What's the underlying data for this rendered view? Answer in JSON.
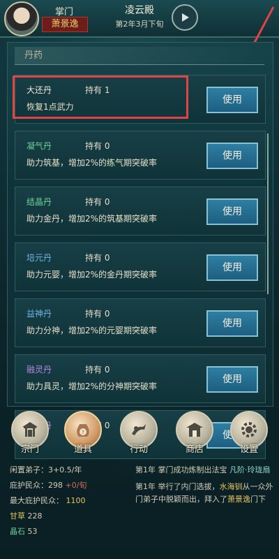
{
  "header": {
    "rank": "掌门",
    "player_name": "萧景逸",
    "sect_name": "凌云殿",
    "date": "第2年3月下旬"
  },
  "section_title": "丹药",
  "items": [
    {
      "name": "大还丹",
      "count_text": "持有 1",
      "desc": "恢复1点武力",
      "button": "使用",
      "name_color": "#f0e8d6"
    },
    {
      "name": "凝气丹",
      "count_text": "持有 0",
      "desc": "助力筑基，增加2%的练气期突破率",
      "button": "使用",
      "name_color": "#6fd19a"
    },
    {
      "name": "结晶丹",
      "count_text": "持有 0",
      "desc": "助力金丹，增加2%的筑基期突破率",
      "button": "使用",
      "name_color": "#6fd19a"
    },
    {
      "name": "培元丹",
      "count_text": "持有 0",
      "desc": "助力元婴，增加2%的金丹期突破率",
      "button": "使用",
      "name_color": "#6fb4e0"
    },
    {
      "name": "益神丹",
      "count_text": "持有 0",
      "desc": "助力分神，增加2%的元婴期突破率",
      "button": "使用",
      "name_color": "#6fb4e0"
    },
    {
      "name": "融灵丹",
      "count_text": "持有 0",
      "desc": "助力具灵，增加2%的分神期突破率",
      "button": "使用",
      "name_color": "#b487e0"
    },
    {
      "name": "化罡丹",
      "count_text": "持有 0",
      "desc": "",
      "button": "使用",
      "name_color": "#b487e0"
    }
  ],
  "nav": [
    {
      "label": "宗门",
      "icon": "gate-icon"
    },
    {
      "label": "道具",
      "icon": "bag-icon"
    },
    {
      "label": "行动",
      "icon": "action-icon"
    },
    {
      "label": "商店",
      "icon": "shop-icon"
    },
    {
      "label": "设置",
      "icon": "gear-icon"
    }
  ],
  "stats": {
    "disciples": "闲置弟子：3+0.5/年",
    "protect": "庇护民众：298",
    "protect_rate": "+0/旬",
    "max_protect_label": "最大庇护民众：",
    "max_protect_value": "1100",
    "herb_label": "甘草",
    "herb_value": "228",
    "crystal_label": "晶石",
    "crystal_value": "53"
  },
  "log": {
    "entry1_prefix": "第1年 掌门成功炼制出法宝",
    "entry1_item": "凡阶·玲珑扇",
    "entry2_prefix": "第1年 举行了内门选拔，",
    "entry2_name1": "水海钏",
    "entry2_mid": "从一众外门弟子中脱颖而出，拜入了",
    "entry2_name2": "萧景逸",
    "entry2_suffix": "门下"
  },
  "colors": {
    "accent_red": "#e04444",
    "use_button": "#2f7ea1"
  }
}
